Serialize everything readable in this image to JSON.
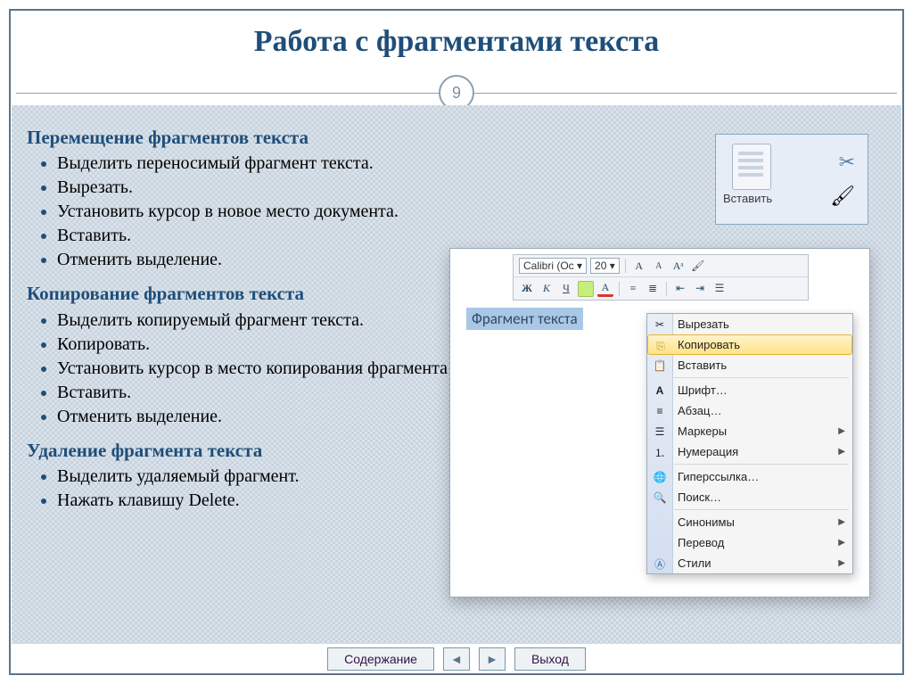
{
  "title": "Работа с фрагментами текста",
  "page_number": "9",
  "sections": [
    {
      "heading": "Перемещение фрагментов текста",
      "items": [
        "Выделить переносимый фрагмент текста.",
        "Вырезать.",
        "Установить курсор в новое место документа.",
        "Вставить.",
        "Отменить выделение."
      ]
    },
    {
      "heading": "Копирование фрагментов текста",
      "items": [
        "Выделить копируемый фрагмент текста.",
        "Копировать.",
        "Установить курсор в место копирования фрагмента текста.",
        "Вставить.",
        "Отменить выделение."
      ]
    },
    {
      "heading": "Удаление фрагмента текста",
      "items": [
        "Выделить удаляемый фрагмент.",
        "Нажать клавишу Delete."
      ]
    }
  ],
  "clipboard": {
    "paste_label": "Вставить"
  },
  "mini_toolbar": {
    "font_family": "Calibri (Ос ▾",
    "font_size": "20 ▾",
    "bold": "Ж",
    "italic": "К",
    "underline": "Ч"
  },
  "word_window": {
    "selected_text": "Фрагмент текста"
  },
  "context_menu": [
    {
      "label": "Вырезать"
    },
    {
      "label": "Копировать"
    },
    {
      "label": "Вставить"
    },
    {
      "label": "Шрифт…"
    },
    {
      "label": "Абзац…"
    },
    {
      "label": "Маркеры"
    },
    {
      "label": "Нумерация"
    },
    {
      "label": "Гиперссылка…"
    },
    {
      "label": "Поиск…"
    },
    {
      "label": "Синонимы"
    },
    {
      "label": "Перевод"
    },
    {
      "label": "Стили"
    }
  ],
  "nav": {
    "contents": "Содержание",
    "exit": "Выход"
  }
}
